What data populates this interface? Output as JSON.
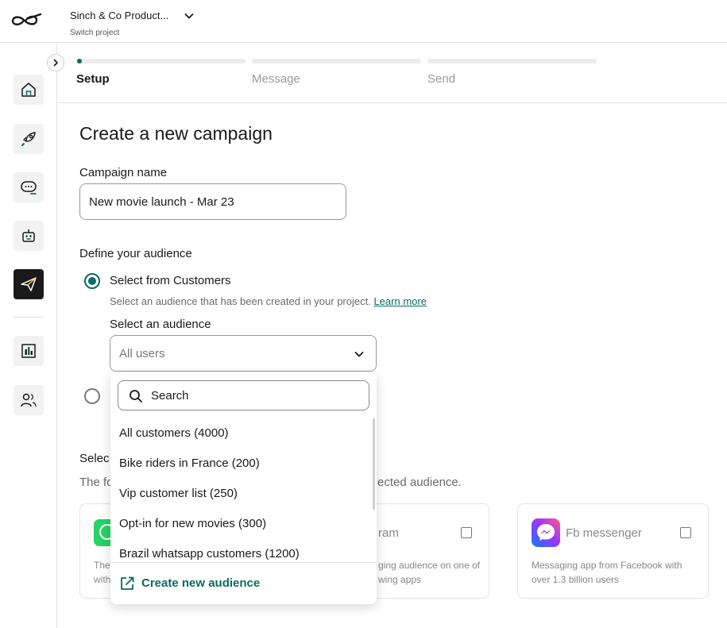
{
  "topbar": {
    "project_name": "Sinch & Co Product...",
    "project_sub": "Switch project"
  },
  "sidebar": {
    "items": [
      {
        "name": "home-icon"
      },
      {
        "name": "rocket-icon"
      },
      {
        "name": "chat-icon"
      },
      {
        "name": "bot-icon"
      },
      {
        "name": "send-icon"
      },
      {
        "name": "analytics-icon"
      },
      {
        "name": "users-icon"
      }
    ],
    "active_item": "send-icon"
  },
  "stepper": {
    "steps": [
      {
        "label": "Setup"
      },
      {
        "label": "Message"
      },
      {
        "label": "Send"
      }
    ]
  },
  "main": {
    "title": "Create a new campaign",
    "campaign_name_label": "Campaign name",
    "campaign_name_value": "New movie launch - Mar 23",
    "audience_heading": "Define your audience",
    "radio_customers_label": "Select from Customers",
    "radio_customers_help": "Select an audience that has been created in your project.",
    "learn_more": "Learn more",
    "select_audience_label": "Select an audience",
    "select_audience_value": "All users"
  },
  "channels": {
    "title_visible": "Selec",
    "desc_left": "The fo",
    "desc_right": "ected audience.",
    "cards": [
      {
        "name": "",
        "desc_a": "The",
        "desc_b": "with"
      },
      {
        "name": "ram",
        "desc_a": "ging audience on one of",
        "desc_b": "wing apps"
      },
      {
        "name": "Fb messenger",
        "desc_a": "Messaging app from Facebook with",
        "desc_b": "over 1.3 billion users"
      }
    ]
  },
  "dropdown": {
    "search_placeholder": "Search",
    "options": [
      "All customers (4000)",
      "Bike riders in France (200)",
      "Vip customer list (250)",
      "Opt-in for new movies (300)",
      "Brazil whatsapp customers (1200)"
    ],
    "create_label": "Create new audience"
  },
  "colors": {
    "accent": "#0b6b63",
    "border": "#e3e3e3",
    "active_nav": "#1a1a1a"
  }
}
